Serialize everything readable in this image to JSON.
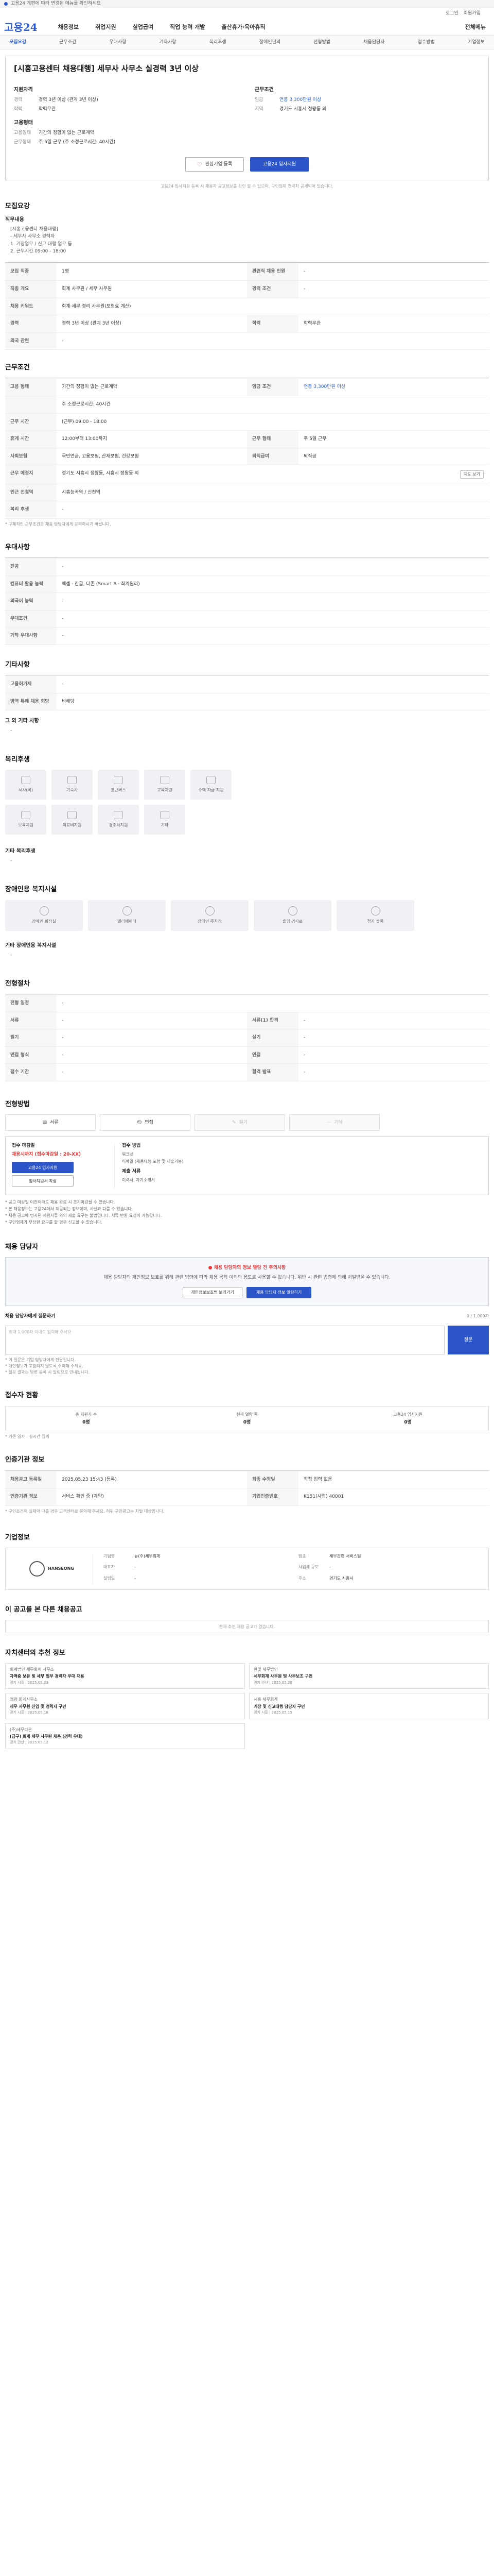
{
  "topnotice": {
    "text": "고용24 개편에 따라 변경된 메뉴를 확인하세요"
  },
  "util": [
    "로그인",
    "회원가입"
  ],
  "header": {
    "logo": "고용24",
    "gnb": [
      "채용정보",
      "취업지원",
      "실업급여",
      "직업 능력 개발",
      "출산휴가·육아휴직"
    ],
    "gnb_tail": "전체메뉴"
  },
  "anchors": [
    "모집요강",
    "근무조건",
    "우대사항",
    "기타사항",
    "복리후생",
    "장애인편의",
    "전형방법",
    "채용담당자",
    "접수방법",
    "기업정보"
  ],
  "summary": {
    "title": "[시흥고용센터 채용대행] 세무사 사무소 실경력 3년 이상",
    "left_head": "지원자격",
    "left_rows": [
      {
        "k": "경력",
        "v": "경력 3년 이상 (관계 3년 이상)"
      },
      {
        "k": "학력",
        "v": "학력무관"
      }
    ],
    "left_head2": "고용형태",
    "left_rows2": [
      {
        "k": "고용형태",
        "v": "기간의 정함이 없는 근로계약"
      },
      {
        "k": "근무형태",
        "v": "주 5일 근무 (주 소정근로시간: 40시간)"
      }
    ],
    "right_head": "근무조건",
    "right_rows": [
      {
        "k": "임금",
        "v": "연봉 3,300만원 이상"
      },
      {
        "k": "지역",
        "v": "경기도 시흥시 정왕동 외 "
      }
    ],
    "btn_interest": "관심기업 등록",
    "btn_apply": "고용24 입사지원",
    "note": "고용24 입사지원 등록 시 채용자 공고정보를 확인 할 수 있으며, 구인업체 연락처 공개되어 있습니다."
  },
  "recruit": {
    "title": "모집요강",
    "job_head": "직무내용",
    "job_lines": [
      "[시흥고용센터 채용대행]",
      "- 세무사 사무소 경력자",
      "1. 기장업무 / 신고 대행 업무 등",
      "2. 근무시간 09:00 - 18:00"
    ],
    "rows": [
      [
        {
          "k": "모집 직종",
          "v": "1명"
        },
        {
          "k": "관련직 채용 인원",
          "v": "-"
        }
      ],
      [
        {
          "k": "직종 개요",
          "v": "회계 사무원 / 세무 사무원"
        },
        {
          "k": "경력 조건",
          "v": "-"
        }
      ],
      [
        {
          "k": "채용 키워드",
          "v": "회계·세무·경리 사무원(보험료 계산)"
        },
        {
          "k": "",
          "v": ""
        }
      ],
      [
        {
          "k": "경력",
          "v": "경력 3년 이상 (관계 3년 이상)"
        },
        {
          "k": "학력",
          "v": "학력무관"
        }
      ],
      [
        {
          "k": "외국 관련",
          "v": "-"
        },
        {
          "k": "",
          "v": ""
        }
      ]
    ]
  },
  "conditions": {
    "title": "근무조건",
    "rows": [
      [
        {
          "k": "고용 형태",
          "v": "기간의 정함이 없는 근로계약"
        },
        {
          "k": "임금 조건",
          "v": "연봉 3,300만원 이상"
        }
      ],
      [
        {
          "k": "",
          "v": "주 소정근로시간: 40시간"
        },
        {
          "k": "",
          "v": ""
        }
      ],
      [
        {
          "k": "근무 시간",
          "v": "(근무) 09:00 - 18:00"
        },
        {
          "k": "",
          "v": ""
        }
      ],
      [
        {
          "k": "휴게 시간",
          "v": "12:00부터 13:00까지"
        },
        {
          "k": "근무 형태",
          "v": "주 5일 근무"
        }
      ],
      [
        {
          "k": "사회보험",
          "v": "국민연금, 고용보험, 산재보험, 건강보험"
        },
        {
          "k": "퇴직급여",
          "v": "퇴직금"
        }
      ],
      [
        {
          "k": "근무 예정지",
          "v": "경기도 시흥시 정왕동, 시흥시 정왕동 외"
        },
        {
          "k": "",
          "v": ""
        }
      ],
      [
        {
          "k": "인근 전철역",
          "v": "시흥능곡역 / 신천역"
        },
        {
          "k": "",
          "v": ""
        }
      ],
      [
        {
          "k": "복리 후생",
          "v": "-"
        },
        {
          "k": "",
          "v": ""
        }
      ]
    ],
    "map_btn": "지도 보기",
    "note": "* 구체적인 근무조건은 채용 담당자에게 문의하시기 바랍니다."
  },
  "preference": {
    "title": "우대사항",
    "rows": [
      [
        {
          "k": "전공",
          "v": "-"
        }
      ],
      [
        {
          "k": "컴퓨터 활용 능력",
          "v": "엑셀 · 한글, 더존 (Smart A · 회계원리)"
        }
      ],
      [
        {
          "k": "외국어 능력",
          "v": "-"
        }
      ],
      [
        {
          "k": "우대조건",
          "v": "-"
        }
      ],
      [
        {
          "k": "기타 우대사항",
          "v": "-"
        }
      ]
    ]
  },
  "etc": {
    "title": "기타사항",
    "rows": [
      [
        {
          "k": "고용허가제",
          "v": "-"
        }
      ],
      [
        {
          "k": "병역 특례 채용 희망",
          "v": "비해당"
        }
      ]
    ],
    "extra_head": "그 외 기타 사항",
    "extra_val": "-"
  },
  "welfare": {
    "title": "복리후생",
    "items": [
      "식사(비)",
      "기숙사",
      "통근버스",
      "교육지원",
      "주택 자금 지원",
      "보육지원",
      "의료비지원",
      "경조사지원",
      "기타"
    ],
    "extra_head": "기타 복리후생",
    "extra_val": "-"
  },
  "disability": {
    "title": "장애인용 복지시설",
    "items": [
      "장애인 화장실",
      "엘리베이터",
      "장애인 주차장",
      "출입 경사로",
      "점자 블록"
    ],
    "extra_head": "기타 장애인용 복지시설",
    "extra_val": "-"
  },
  "process": {
    "title": "전형절차",
    "rows": [
      [
        {
          "k": "전형 일정",
          "v": "-"
        }
      ],
      [
        {
          "k": "서류",
          "v": "-"
        },
        {
          "k": "서류(1) 합격",
          "v": "-"
        }
      ],
      [
        {
          "k": "필기",
          "v": "-"
        },
        {
          "k": "실기",
          "v": "-"
        }
      ],
      [
        {
          "k": "면접 형식",
          "v": "-"
        },
        {
          "k": "면접",
          "v": "-"
        }
      ],
      [
        {
          "k": "접수 기간",
          "v": "-"
        },
        {
          "k": "합격 발표",
          "v": "-"
        }
      ]
    ]
  },
  "apply": {
    "title": "전형방법",
    "methods": [
      "서류",
      "면접",
      "필기",
      "기타"
    ],
    "period_head": "접수 마감일",
    "deadline": "채용시까지 (접수마감일 : 20-XX)",
    "btn1": "고용24 입사지원",
    "btn2": "입사지원서 작성",
    "howto_head": "접수 방법",
    "howto_lines": [
      "워크넷",
      "이메일 (채용대행 포함 및 제출가능)"
    ],
    "docs_head": "제출 서류",
    "docs": "이력서, 자기소개서",
    "info": [
      "* 공고 마감일 이전이라도 채용 완료 시 조기마감될 수 있습니다.",
      "* 본 채용정보는 고용24에서 제공되는 정보이며, 사실과 다를 수 있습니다.",
      "* 채용 공고에 명시된 지원서류 외의 제출 요구는 불법입니다. 서류 반환 요청이 가능합니다.",
      "* 구인업체가 부당한 요구를 할 경우 신고할 수 있습니다."
    ]
  },
  "manager": {
    "title": "채용 담당자",
    "warn": "채용 담당자의 정보 열람 전 주의사항",
    "text": "채용 담당자의 개인정보 보호를 위해 관련 법령에 따라 채용 목적 이외의 용도로 사용할 수 없습니다. 위반 시 관련 법령에 의해 처벌받을 수 있습니다.",
    "btn1": "개인정보보호법 보러가기",
    "btn2": "채용 담당자 정보 열람하기",
    "q_head": "채용 담당자에게 질문하기",
    "q_count": "0 / 1,000자",
    "q_placeholder": "최대 1,000자 이내로 입력해 주세요",
    "q_btn": "질문",
    "notes": [
      "* 이 질문은 기업 담당자에게 전달됩니다.",
      "* 개인정보가 포함되지 않도록 주의해 주세요.",
      "* 질문 결과는 답변 등록 시 알림으로 안내됩니다."
    ]
  },
  "stats": {
    "title": "접수자 현황",
    "items": [
      {
        "k": "총 지원자 수",
        "v": "0명"
      },
      {
        "k": "현재 열람 중",
        "v": "0명"
      },
      {
        "k": "고용24 입사지원",
        "v": "0명"
      }
    ],
    "note": "* 기준 일자 : 실시간 집계"
  },
  "jobinfo": {
    "title": "인증기관 정보",
    "rows": [
      [
        {
          "k": "채용공고 등록일",
          "v": "2025.05.23 15:43 (등록)"
        },
        {
          "k": "최종 수정일",
          "v": "직접 입력 없음"
        }
      ],
      [
        {
          "k": "인증기관 정보",
          "v": "서비스 확인 중 (계약)"
        },
        {
          "k": "기업인증번호",
          "v": "K151(사업) 40001"
        }
      ]
    ],
    "note": "* 구인조건이 실제와 다를 경우 고객센터로 문의해 주세요. 허위 구인광고는 처벌 대상입니다."
  },
  "company": {
    "title": "기업정보",
    "logo_text": "HANSEONG",
    "rows": [
      {
        "k": "기업명",
        "v": "뉴(주)세무회계"
      },
      {
        "k": "업종",
        "v": "세무관련 서비스업"
      },
      {
        "k": "대표자",
        "v": "-"
      },
      {
        "k": "사업체 규모",
        "v": "-"
      },
      {
        "k": "설립일",
        "v": "-"
      },
      {
        "k": "주소",
        "v": "경기도 시흥시"
      }
    ]
  },
  "similar": {
    "title": "이 공고를 본 다른 채용공고",
    "empty": "현재 추천 채용 공고가 없습니다."
  },
  "recommend": {
    "title": "자치센터의 추천 정보",
    "items": [
      {
        "co": "회계법인 세무회계 사무소",
        "t": "자격증 보유 및 세무 업무 경력자 우대 채용",
        "m": "경기 시흥 | 2025.05.23"
      },
      {
        "co": "한빛 세무법인",
        "t": "세무회계 사무원 및 사무보조 구인",
        "m": "경기 안산 | 2025.05.20"
      },
      {
        "co": "정왕 회계사무소",
        "t": "세무 사무원 신입 및 경력자 구인",
        "m": "경기 시흥 | 2025.05.18"
      },
      {
        "co": "시흥 세무회계",
        "t": "기장 및 신고대행 담당자 구인",
        "m": "경기 시흥 | 2025.05.15"
      },
      {
        "co": "(주)세무다온",
        "t": "[급구] 회계 세무 사무원 채용 (경력 우대)",
        "m": "경기 안산 | 2025.05.12"
      }
    ]
  }
}
